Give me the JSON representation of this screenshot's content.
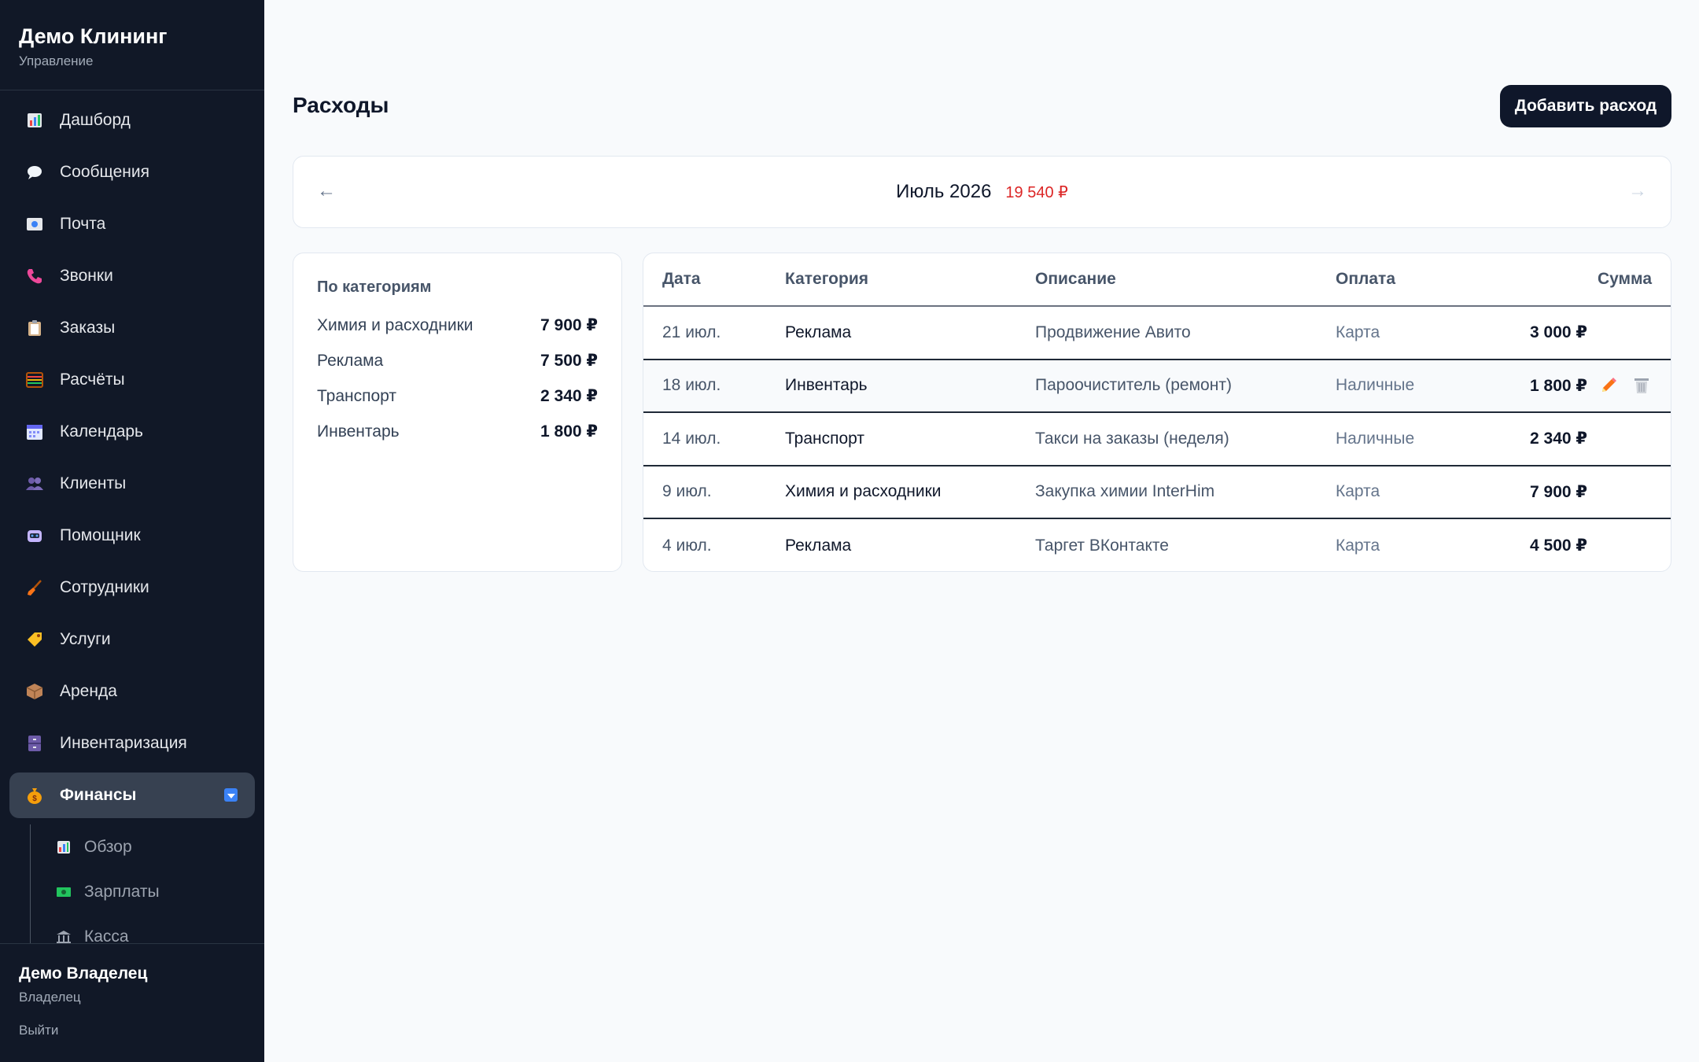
{
  "brand": {
    "title": "Демо Клининг",
    "subtitle": "Управление"
  },
  "nav": {
    "items": [
      {
        "label": "Дашборд",
        "icon": "chart-icon"
      },
      {
        "label": "Сообщения",
        "icon": "speech-bubble-icon"
      },
      {
        "label": "Почта",
        "icon": "mail-icon"
      },
      {
        "label": "Звонки",
        "icon": "phone-icon"
      },
      {
        "label": "Заказы",
        "icon": "clipboard-icon"
      },
      {
        "label": "Расчёты",
        "icon": "abacus-icon"
      },
      {
        "label": "Календарь",
        "icon": "calendar-icon"
      },
      {
        "label": "Клиенты",
        "icon": "users-icon"
      },
      {
        "label": "Помощник",
        "icon": "robot-icon"
      },
      {
        "label": "Сотрудники",
        "icon": "broom-icon"
      },
      {
        "label": "Услуги",
        "icon": "tag-icon"
      },
      {
        "label": "Аренда",
        "icon": "box-icon"
      },
      {
        "label": "Инвентаризация",
        "icon": "cabinet-icon"
      },
      {
        "label": "Финансы",
        "icon": "money-bag-icon",
        "active": true
      }
    ],
    "sub_items": [
      {
        "label": "Обзор",
        "icon": "chart-icon"
      },
      {
        "label": "Зарплаты",
        "icon": "banknote-icon"
      },
      {
        "label": "Касса",
        "icon": "bank-icon"
      }
    ]
  },
  "user": {
    "name": "Демо Владелец",
    "role": "Владелец",
    "logout": "Выйти"
  },
  "page": {
    "title": "Расходы",
    "add_button": "Добавить расход"
  },
  "month": {
    "prev": "←",
    "next": "→",
    "label": "Июль 2026",
    "total": "19 540 ₽"
  },
  "categories": {
    "title": "По категориям",
    "rows": [
      {
        "name": "Химия и расходники",
        "amount": "7 900 ₽"
      },
      {
        "name": "Реклама",
        "amount": "7 500 ₽"
      },
      {
        "name": "Транспорт",
        "amount": "2 340 ₽"
      },
      {
        "name": "Инвентарь",
        "amount": "1 800 ₽"
      }
    ]
  },
  "table": {
    "headers": {
      "date": "Дата",
      "category": "Категория",
      "description": "Описание",
      "payment": "Оплата",
      "sum": "Сумма"
    },
    "rows": [
      {
        "date": "21 июл.",
        "category": "Реклама",
        "description": "Продвижение Авито",
        "payment": "Карта",
        "sum": "3 000 ₽"
      },
      {
        "date": "18 июл.",
        "category": "Инвентарь",
        "description": "Пароочиститель (ремонт)",
        "payment": "Наличные",
        "sum": "1 800 ₽"
      },
      {
        "date": "14 июл.",
        "category": "Транспорт",
        "description": "Такси на заказы (неделя)",
        "payment": "Наличные",
        "sum": "2 340 ₽"
      },
      {
        "date": "9 июл.",
        "category": "Химия и расходники",
        "description": "Закупка химии InterHim",
        "payment": "Карта",
        "sum": "7 900 ₽"
      },
      {
        "date": "4 июл.",
        "category": "Реклама",
        "description": "Таргет ВКонтакте",
        "payment": "Карта",
        "sum": "4 500 ₽"
      }
    ]
  },
  "colors": {
    "sidebar": "#111827",
    "accent": "#0f172a",
    "negative": "#dc2626",
    "edit": "#f97316"
  }
}
